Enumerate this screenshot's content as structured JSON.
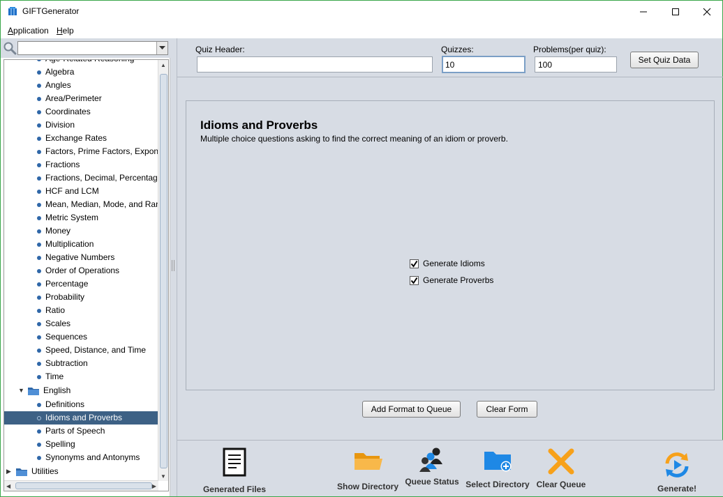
{
  "window": {
    "title": "GIFTGenerator",
    "colors": {
      "frame_border": "#3aa64a",
      "panel_bg": "#d7dce4",
      "selection": "#3d6185",
      "accent_orange": "#f7a11a",
      "accent_blue": "#1e88e5"
    }
  },
  "menu": {
    "items": [
      {
        "label": "Application"
      },
      {
        "label": "Help"
      }
    ]
  },
  "search": {
    "value": ""
  },
  "tree": {
    "math_items": [
      "Age-Related Reasoning",
      "Algebra",
      "Angles",
      "Area/Perimeter",
      "Coordinates",
      "Division",
      "Exchange Rates",
      "Factors, Prime Factors, Exponents",
      "Fractions",
      "Fractions, Decimal, Percentages",
      "HCF and LCM",
      "Mean, Median, Mode, and Range",
      "Metric System",
      "Money",
      "Multiplication",
      "Negative Numbers",
      "Order of Operations",
      "Percentage",
      "Probability",
      "Ratio",
      "Scales",
      "Sequences",
      "Speed, Distance, and Time",
      "Subtraction",
      "Time"
    ],
    "english_folder": "English",
    "english_items": [
      "Definitions",
      "Idioms and Proverbs",
      "Parts of Speech",
      "Spelling",
      "Synonyms and Antonyms"
    ],
    "selected": "Idioms and Proverbs",
    "utilities_folder": "Utilities"
  },
  "form": {
    "quiz_header_label": "Quiz Header:",
    "quiz_header_value": "",
    "quizzes_label": "Quizzes:",
    "quizzes_value": "10",
    "problems_label": "Problems(per quiz):",
    "problems_value": "100",
    "set_button": "Set Quiz Data"
  },
  "panel": {
    "title": "Idioms and Proverbs",
    "description": "Multiple choice questions asking to find the correct meaning of an idiom or proverb.",
    "options": [
      {
        "label": "Generate Idioms",
        "checked": true
      },
      {
        "label": "Generate Proverbs",
        "checked": true
      }
    ]
  },
  "actions": {
    "add": "Add Format to Queue",
    "clear": "Clear Form"
  },
  "toolbar": {
    "generated_files": "Generated Files",
    "show_directory": "Show Directory",
    "queue_status": "Queue Status",
    "select_directory": "Select Directory",
    "clear_queue": "Clear Queue",
    "generate": "Generate!"
  }
}
